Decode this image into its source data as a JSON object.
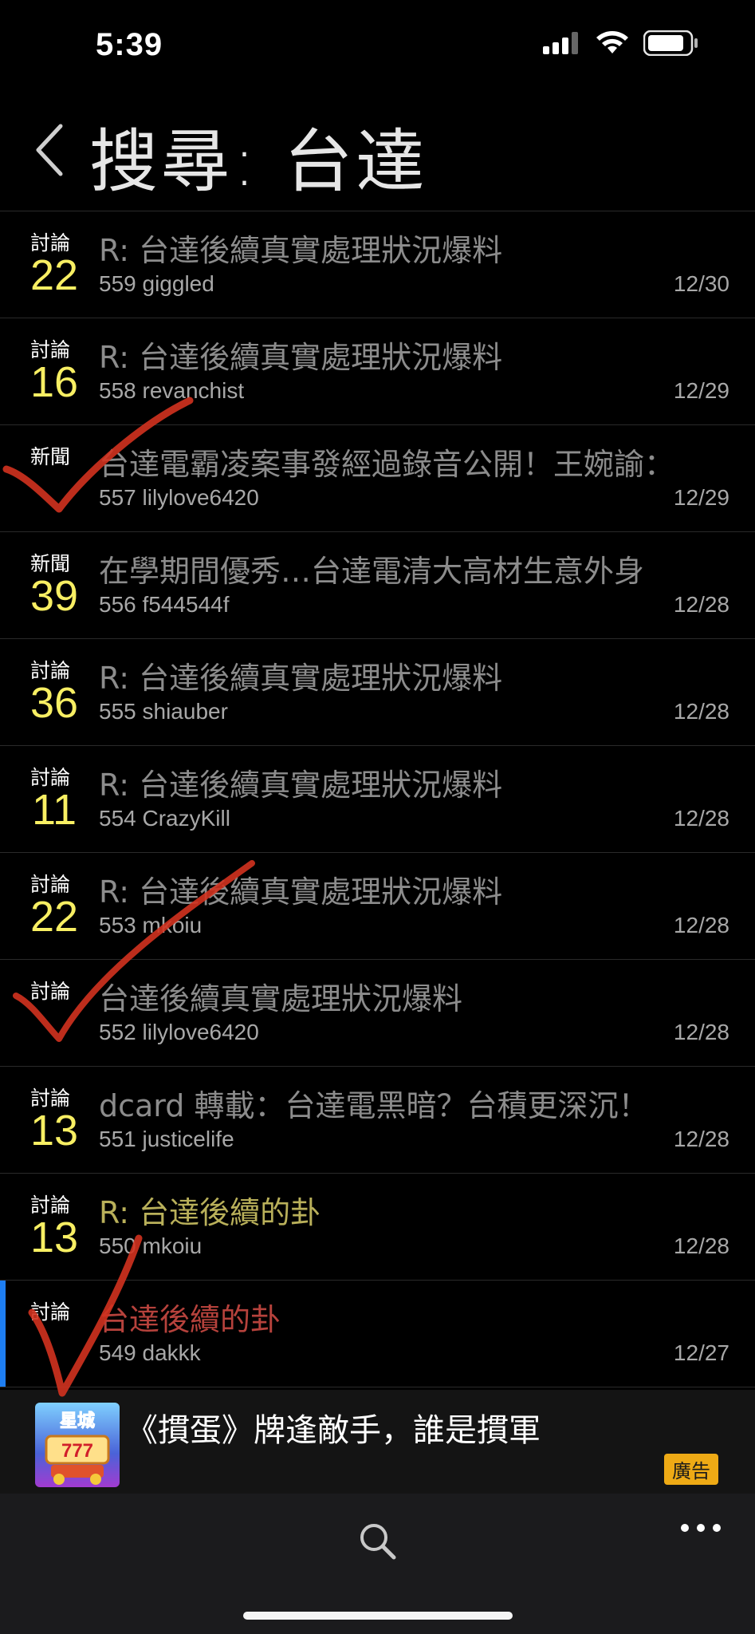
{
  "status_bar": {
    "time": "5:39"
  },
  "header": {
    "title": "搜尋: 台達",
    "back_icon": "chevron-left-icon"
  },
  "results": [
    {
      "category": "討論",
      "count": "22",
      "title": "R: 台達後續真實處理狀況爆料",
      "number": "559",
      "author": "giggled",
      "date": "12/30"
    },
    {
      "category": "討論",
      "count": "16",
      "title": "R: 台達後續真實處理狀況爆料",
      "number": "558",
      "author": "revanchist",
      "date": "12/29"
    },
    {
      "category": "新聞",
      "count": "",
      "title": "台達電霸凌案事發經過錄音公開！王婉諭：",
      "number": "557",
      "author": "lilylove6420",
      "date": "12/29"
    },
    {
      "category": "新聞",
      "count": "39",
      "title": "在學期間優秀…台達電清大高材生意外身",
      "number": "556",
      "author": "f544544f",
      "date": "12/28"
    },
    {
      "category": "討論",
      "count": "36",
      "title": "R: 台達後續真實處理狀況爆料",
      "number": "555",
      "author": "shiauber",
      "date": "12/28"
    },
    {
      "category": "討論",
      "count": "11",
      "title": "R: 台達後續真實處理狀況爆料",
      "number": "554",
      "author": "CrazyKill",
      "date": "12/28"
    },
    {
      "category": "討論",
      "count": "22",
      "title": "R: 台達後續真實處理狀況爆料",
      "number": "553",
      "author": "mkoiu",
      "date": "12/28"
    },
    {
      "category": "討論",
      "count": "",
      "title": "台達後續真實處理狀況爆料",
      "number": "552",
      "author": "lilylove6420",
      "date": "12/28"
    },
    {
      "category": "討論",
      "count": "13",
      "title": "dcard 轉載：台達電黑暗？台積更深沉！",
      "number": "551",
      "author": "justicelife",
      "date": "12/28"
    },
    {
      "category": "討論",
      "count": "13",
      "title": "R: 台達後續的卦",
      "number": "550",
      "author": "mkoiu",
      "date": "12/28"
    },
    {
      "category": "討論",
      "count": "",
      "title": "台達後續的卦",
      "number": "549",
      "author": "dakkk",
      "date": "12/27"
    }
  ],
  "ad": {
    "text": "《摜蛋》牌逢敵手，誰是摜軍",
    "badge": "廣告",
    "icon_text": "星城",
    "icon_number": "777"
  },
  "toolbar": {
    "search_icon": "search-icon",
    "more_icon": "more-horizontal-icon"
  },
  "colors": {
    "count_yellow": "#f8ef63",
    "selected_bar": "#1e7ef2",
    "ad_badge": "#eeaa15",
    "check_mark": "#d2321f"
  }
}
